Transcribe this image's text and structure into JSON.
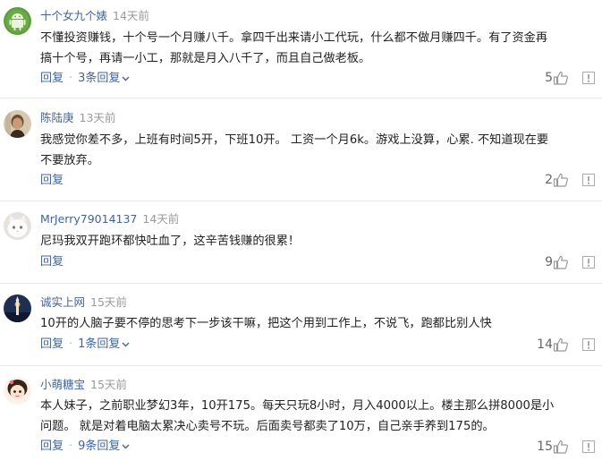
{
  "comments": [
    {
      "username": "十个女九个婊",
      "time": "14天前",
      "text": "不懂投资赚钱，十个号一个月赚八千。拿四千出来请小工代玩，什么都不做月赚四千。有了资金再搞十个号，再请一小工，那就是月入八千了，而且自己做老板。",
      "reply_label": "回复",
      "replies_label": "3条回复",
      "likes": "5",
      "avatar_icon": "android-robot-avatar"
    },
    {
      "username": "陈陆庚",
      "time": "13天前",
      "text": "我感觉你差不多，上班有时间5开，下班10开。 工资一个月6k。游戏上没算，心累. 不知道现在要不要放弃。",
      "reply_label": "回复",
      "replies_label": "",
      "likes": "2",
      "avatar_icon": "portrait-avatar"
    },
    {
      "username": "MrJerry79014137",
      "time": "14天前",
      "text": "尼玛我双开跑环都快吐血了，这辛苦钱赚的很累！",
      "reply_label": "回复",
      "replies_label": "",
      "likes": "9",
      "avatar_icon": "white-cat-avatar"
    },
    {
      "username": "诚实上网",
      "time": "15天前",
      "text": "10开的人脑子要不停的思考下一步该干嘛，把这个用到工作上，不说飞，跑都比别人快",
      "reply_label": "回复",
      "replies_label": "1条回复",
      "likes": "14",
      "avatar_icon": "night-tower-avatar"
    },
    {
      "username": "小萌糖宝",
      "time": "15天前",
      "text": "本人妹子，之前职业梦幻3年，10开175。每天只玩8小时，月入4000以上。楼主那么拼8000是小问题。 就是对着电脑太累决心卖号不玩。后面卖号都卖了10万，自己亲手养到175的。",
      "reply_label": "回复",
      "replies_label": "9条回复",
      "likes": "15",
      "avatar_icon": "cartoon-girl-avatar"
    }
  ],
  "colors": {
    "username": "#406599",
    "time": "#999999",
    "link": "#406599",
    "divider": "#e8e8e8"
  }
}
